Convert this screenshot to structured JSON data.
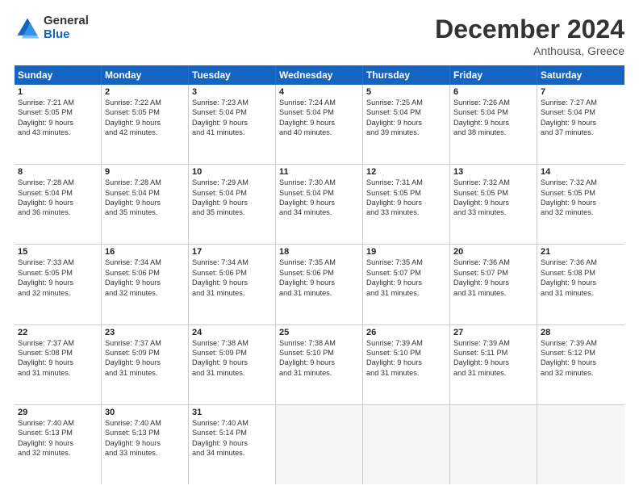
{
  "header": {
    "logo_general": "General",
    "logo_blue": "Blue",
    "title": "December 2024",
    "location": "Anthousa, Greece"
  },
  "weekdays": [
    "Sunday",
    "Monday",
    "Tuesday",
    "Wednesday",
    "Thursday",
    "Friday",
    "Saturday"
  ],
  "rows": [
    [
      {
        "day": "1",
        "lines": [
          "Sunrise: 7:21 AM",
          "Sunset: 5:05 PM",
          "Daylight: 9 hours",
          "and 43 minutes."
        ]
      },
      {
        "day": "2",
        "lines": [
          "Sunrise: 7:22 AM",
          "Sunset: 5:05 PM",
          "Daylight: 9 hours",
          "and 42 minutes."
        ]
      },
      {
        "day": "3",
        "lines": [
          "Sunrise: 7:23 AM",
          "Sunset: 5:04 PM",
          "Daylight: 9 hours",
          "and 41 minutes."
        ]
      },
      {
        "day": "4",
        "lines": [
          "Sunrise: 7:24 AM",
          "Sunset: 5:04 PM",
          "Daylight: 9 hours",
          "and 40 minutes."
        ]
      },
      {
        "day": "5",
        "lines": [
          "Sunrise: 7:25 AM",
          "Sunset: 5:04 PM",
          "Daylight: 9 hours",
          "and 39 minutes."
        ]
      },
      {
        "day": "6",
        "lines": [
          "Sunrise: 7:26 AM",
          "Sunset: 5:04 PM",
          "Daylight: 9 hours",
          "and 38 minutes."
        ]
      },
      {
        "day": "7",
        "lines": [
          "Sunrise: 7:27 AM",
          "Sunset: 5:04 PM",
          "Daylight: 9 hours",
          "and 37 minutes."
        ]
      }
    ],
    [
      {
        "day": "8",
        "lines": [
          "Sunrise: 7:28 AM",
          "Sunset: 5:04 PM",
          "Daylight: 9 hours",
          "and 36 minutes."
        ]
      },
      {
        "day": "9",
        "lines": [
          "Sunrise: 7:28 AM",
          "Sunset: 5:04 PM",
          "Daylight: 9 hours",
          "and 35 minutes."
        ]
      },
      {
        "day": "10",
        "lines": [
          "Sunrise: 7:29 AM",
          "Sunset: 5:04 PM",
          "Daylight: 9 hours",
          "and 35 minutes."
        ]
      },
      {
        "day": "11",
        "lines": [
          "Sunrise: 7:30 AM",
          "Sunset: 5:04 PM",
          "Daylight: 9 hours",
          "and 34 minutes."
        ]
      },
      {
        "day": "12",
        "lines": [
          "Sunrise: 7:31 AM",
          "Sunset: 5:05 PM",
          "Daylight: 9 hours",
          "and 33 minutes."
        ]
      },
      {
        "day": "13",
        "lines": [
          "Sunrise: 7:32 AM",
          "Sunset: 5:05 PM",
          "Daylight: 9 hours",
          "and 33 minutes."
        ]
      },
      {
        "day": "14",
        "lines": [
          "Sunrise: 7:32 AM",
          "Sunset: 5:05 PM",
          "Daylight: 9 hours",
          "and 32 minutes."
        ]
      }
    ],
    [
      {
        "day": "15",
        "lines": [
          "Sunrise: 7:33 AM",
          "Sunset: 5:05 PM",
          "Daylight: 9 hours",
          "and 32 minutes."
        ]
      },
      {
        "day": "16",
        "lines": [
          "Sunrise: 7:34 AM",
          "Sunset: 5:06 PM",
          "Daylight: 9 hours",
          "and 32 minutes."
        ]
      },
      {
        "day": "17",
        "lines": [
          "Sunrise: 7:34 AM",
          "Sunset: 5:06 PM",
          "Daylight: 9 hours",
          "and 31 minutes."
        ]
      },
      {
        "day": "18",
        "lines": [
          "Sunrise: 7:35 AM",
          "Sunset: 5:06 PM",
          "Daylight: 9 hours",
          "and 31 minutes."
        ]
      },
      {
        "day": "19",
        "lines": [
          "Sunrise: 7:35 AM",
          "Sunset: 5:07 PM",
          "Daylight: 9 hours",
          "and 31 minutes."
        ]
      },
      {
        "day": "20",
        "lines": [
          "Sunrise: 7:36 AM",
          "Sunset: 5:07 PM",
          "Daylight: 9 hours",
          "and 31 minutes."
        ]
      },
      {
        "day": "21",
        "lines": [
          "Sunrise: 7:36 AM",
          "Sunset: 5:08 PM",
          "Daylight: 9 hours",
          "and 31 minutes."
        ]
      }
    ],
    [
      {
        "day": "22",
        "lines": [
          "Sunrise: 7:37 AM",
          "Sunset: 5:08 PM",
          "Daylight: 9 hours",
          "and 31 minutes."
        ]
      },
      {
        "day": "23",
        "lines": [
          "Sunrise: 7:37 AM",
          "Sunset: 5:09 PM",
          "Daylight: 9 hours",
          "and 31 minutes."
        ]
      },
      {
        "day": "24",
        "lines": [
          "Sunrise: 7:38 AM",
          "Sunset: 5:09 PM",
          "Daylight: 9 hours",
          "and 31 minutes."
        ]
      },
      {
        "day": "25",
        "lines": [
          "Sunrise: 7:38 AM",
          "Sunset: 5:10 PM",
          "Daylight: 9 hours",
          "and 31 minutes."
        ]
      },
      {
        "day": "26",
        "lines": [
          "Sunrise: 7:39 AM",
          "Sunset: 5:10 PM",
          "Daylight: 9 hours",
          "and 31 minutes."
        ]
      },
      {
        "day": "27",
        "lines": [
          "Sunrise: 7:39 AM",
          "Sunset: 5:11 PM",
          "Daylight: 9 hours",
          "and 31 minutes."
        ]
      },
      {
        "day": "28",
        "lines": [
          "Sunrise: 7:39 AM",
          "Sunset: 5:12 PM",
          "Daylight: 9 hours",
          "and 32 minutes."
        ]
      }
    ],
    [
      {
        "day": "29",
        "lines": [
          "Sunrise: 7:40 AM",
          "Sunset: 5:13 PM",
          "Daylight: 9 hours",
          "and 32 minutes."
        ]
      },
      {
        "day": "30",
        "lines": [
          "Sunrise: 7:40 AM",
          "Sunset: 5:13 PM",
          "Daylight: 9 hours",
          "and 33 minutes."
        ]
      },
      {
        "day": "31",
        "lines": [
          "Sunrise: 7:40 AM",
          "Sunset: 5:14 PM",
          "Daylight: 9 hours",
          "and 34 minutes."
        ]
      },
      null,
      null,
      null,
      null
    ]
  ]
}
